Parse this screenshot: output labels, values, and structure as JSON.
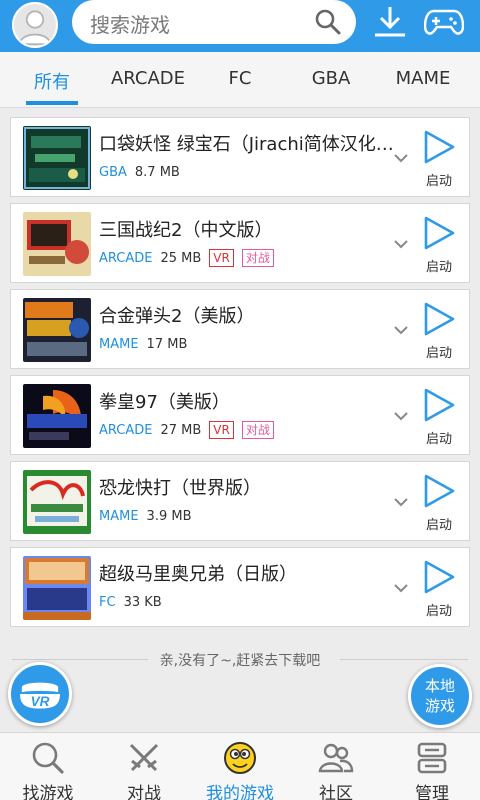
{
  "header": {
    "search_placeholder": "搜索游戏",
    "icons": [
      "avatar",
      "search-icon",
      "download-icon",
      "gamepad-icon"
    ]
  },
  "tabs": [
    {
      "label": "所有",
      "active": true
    },
    {
      "label": "ARCADE",
      "active": false
    },
    {
      "label": "FC",
      "active": false
    },
    {
      "label": "GBA",
      "active": false
    },
    {
      "label": "MAME",
      "active": false
    }
  ],
  "games": [
    {
      "title": "口袋妖怪 绿宝石（Jirachi简体汉化版）",
      "platform": "GBA",
      "size": "8.7 MB",
      "badges": [],
      "action": "启动"
    },
    {
      "title": "三国战纪2（中文版）",
      "platform": "ARCADE",
      "size": "25 MB",
      "badges": [
        "VR",
        "对战"
      ],
      "action": "启动"
    },
    {
      "title": "合金弹头2（美版）",
      "platform": "MAME",
      "size": "17 MB",
      "badges": [],
      "action": "启动"
    },
    {
      "title": "拳皇97（美版）",
      "platform": "ARCADE",
      "size": "27 MB",
      "badges": [
        "VR",
        "对战"
      ],
      "action": "启动"
    },
    {
      "title": "恐龙快打（世界版）",
      "platform": "MAME",
      "size": "3.9 MB",
      "badges": [],
      "action": "启动"
    },
    {
      "title": "超级马里奥兄弟（日版）",
      "platform": "FC",
      "size": "33 KB",
      "badges": [],
      "action": "启动"
    }
  ],
  "end_message": "亲,没有了~,赶紧去下载吧",
  "fab": {
    "vr_label": "VR",
    "local_games_line1": "本地",
    "local_games_line2": "游戏"
  },
  "bottom_nav": [
    {
      "label": "找游戏",
      "icon": "search-icon",
      "active": false
    },
    {
      "label": "对战",
      "icon": "swords-icon",
      "active": false
    },
    {
      "label": "我的游戏",
      "icon": "mascot-icon",
      "active": true
    },
    {
      "label": "社区",
      "icon": "community-icon",
      "active": false
    },
    {
      "label": "管理",
      "icon": "manage-icon",
      "active": false
    }
  ],
  "colors": {
    "primary": "#2f9be8",
    "accent_text": "#1f8fe0",
    "vr_badge": "#d9343a",
    "vs_badge": "#e55b9a"
  }
}
